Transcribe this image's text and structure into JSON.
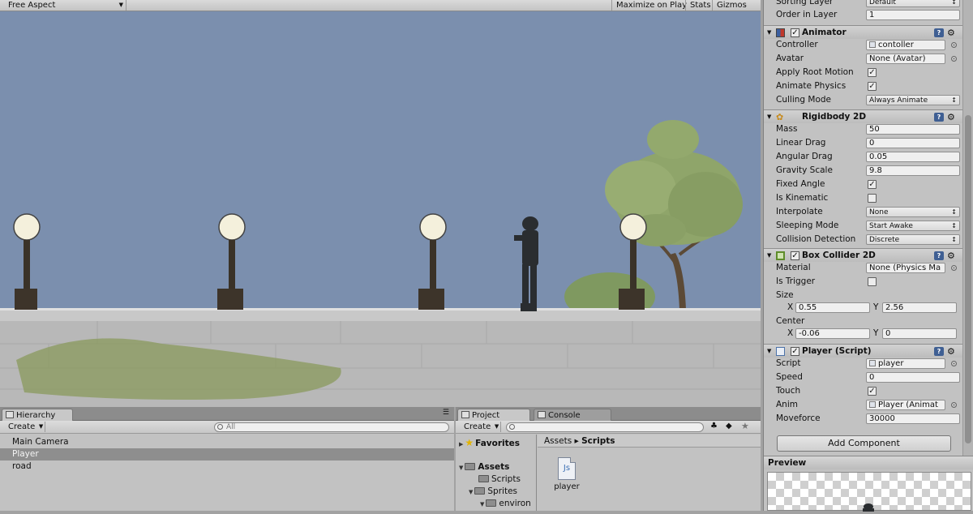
{
  "game_toolbar": {
    "aspect": "Free Aspect",
    "maximize_on_play": "Maximize on Play",
    "stats": "Stats",
    "gizmos": "Gizmos"
  },
  "hierarchy": {
    "tab_label": "Hierarchy",
    "create_label": "Create",
    "search_placeholder": "All",
    "items": [
      "Main Camera",
      "Player",
      "road"
    ],
    "selected": "Player"
  },
  "project": {
    "tab_label": "Project",
    "console_tab_label": "Console",
    "create_label": "Create",
    "favorites_label": "Favorites",
    "tree": [
      "Assets",
      "Scripts",
      "Sprites",
      "environ"
    ],
    "breadcrumb_root": "Assets",
    "breadcrumb_current": "Scripts",
    "assets": [
      {
        "name": "player",
        "icon": "js-file-icon",
        "icon_text": "Js"
      }
    ]
  },
  "inspector": {
    "sorting_layer_label": "Sorting Layer",
    "sorting_layer_value": "Default",
    "order_in_layer_label": "Order in Layer",
    "order_in_layer_value": "1",
    "animator": {
      "title": "Animator",
      "controller_label": "Controller",
      "controller_value": "contoller",
      "avatar_label": "Avatar",
      "avatar_value": "None (Avatar)",
      "apply_root_motion_label": "Apply Root Motion",
      "apply_root_motion": true,
      "animate_physics_label": "Animate Physics",
      "animate_physics": true,
      "culling_mode_label": "Culling Mode",
      "culling_mode_value": "Always Animate"
    },
    "rigidbody2d": {
      "title": "Rigidbody 2D",
      "mass_label": "Mass",
      "mass_value": "50",
      "linear_drag_label": "Linear Drag",
      "linear_drag_value": "0",
      "angular_drag_label": "Angular Drag",
      "angular_drag_value": "0.05",
      "gravity_scale_label": "Gravity Scale",
      "gravity_scale_value": "9.8",
      "fixed_angle_label": "Fixed Angle",
      "fixed_angle": true,
      "is_kinematic_label": "Is Kinematic",
      "is_kinematic": false,
      "interpolate_label": "Interpolate",
      "interpolate_value": "None",
      "sleeping_mode_label": "Sleeping Mode",
      "sleeping_mode_value": "Start Awake",
      "collision_detection_label": "Collision Detection",
      "collision_detection_value": "Discrete"
    },
    "boxcollider2d": {
      "title": "Box Collider 2D",
      "material_label": "Material",
      "material_value": "None (Physics Ma",
      "is_trigger_label": "Is Trigger",
      "is_trigger": false,
      "size_label": "Size",
      "size_x": "0.55",
      "size_y": "2.56",
      "center_label": "Center",
      "center_x": "-0.06",
      "center_y": "0",
      "x_label": "X",
      "y_label": "Y"
    },
    "player_script": {
      "title": "Player (Script)",
      "script_label": "Script",
      "script_value": "player",
      "speed_label": "Speed",
      "speed_value": "0",
      "touch_label": "Touch",
      "touch": true,
      "anim_label": "Anim",
      "anim_value": "Player (Animat",
      "moveforce_label": "Moveforce",
      "moveforce_value": "30000"
    },
    "add_component_label": "Add Component"
  },
  "preview": {
    "title": "Preview"
  },
  "colors": {
    "sky": "#7b8fae",
    "panel_bg": "#c2c2c2",
    "selection": "#8e8e8e"
  }
}
